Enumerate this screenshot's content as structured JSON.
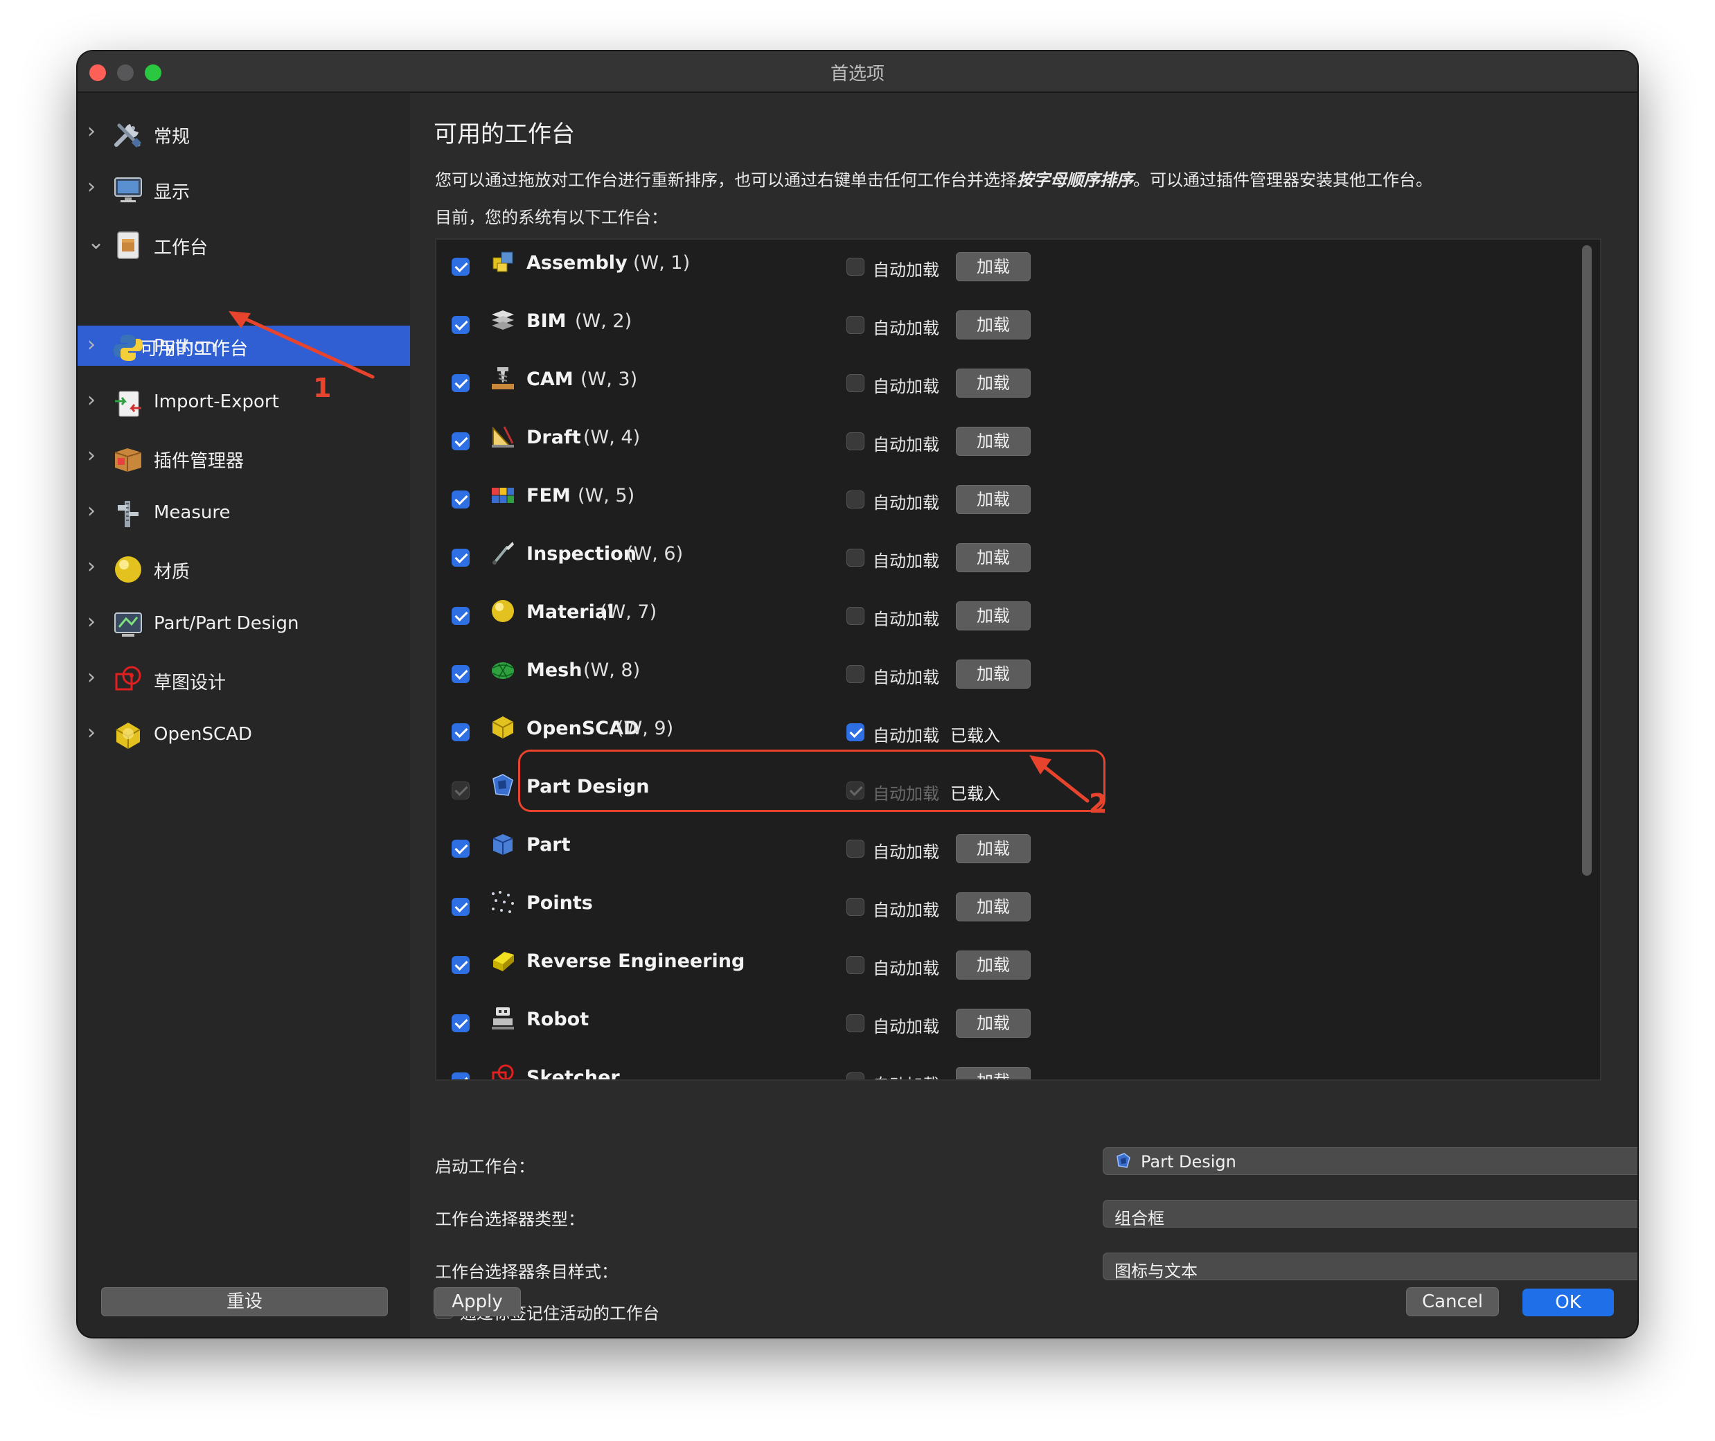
{
  "window": {
    "title": "首选项"
  },
  "sidebar": {
    "items": [
      {
        "label": "常规",
        "chevron": "›",
        "icon": "tools-icon"
      },
      {
        "label": "显示",
        "chevron": "›",
        "icon": "monitor-icon"
      },
      {
        "label": "工作台",
        "chevron": "⌄",
        "icon": "workbench-icon"
      },
      {
        "label": "可用的工作台",
        "selected": true
      },
      {
        "label": "Python",
        "chevron": "›",
        "icon": "python-icon"
      },
      {
        "label": "Import-Export",
        "chevron": "›",
        "icon": "import-export-icon"
      },
      {
        "label": "插件管理器",
        "chevron": "›",
        "icon": "addon-manager-icon"
      },
      {
        "label": "Measure",
        "chevron": "›",
        "icon": "measure-icon"
      },
      {
        "label": "材质",
        "chevron": "›",
        "icon": "material-icon"
      },
      {
        "label": "Part/Part Design",
        "chevron": "›",
        "icon": "part-design-icon"
      },
      {
        "label": "草图设计",
        "chevron": "›",
        "icon": "sketcher-icon"
      },
      {
        "label": "OpenSCAD",
        "chevron": "›",
        "icon": "openscad-icon"
      }
    ],
    "reset_label": "重设"
  },
  "main": {
    "heading": "可用的工作台",
    "description_before": "您可以通过拖放对工作台进行重新排序，也可以通过右键单击任何工作台并选择",
    "description_em": "按字母顺序排序",
    "description_after": "。可以通过插件管理器安装其他工作台。",
    "subdescription": "目前，您的系统有以下工作台：",
    "autoload_label": "自动加载",
    "load_label": "加载",
    "loaded_label": "已载入",
    "workbenches": [
      {
        "name": "Assembly",
        "code": "(W, 1)",
        "enabled": true,
        "autoload": false,
        "loaded": false,
        "icon": "assembly-icon"
      },
      {
        "name": "BIM",
        "code": "(W, 2)",
        "enabled": true,
        "autoload": false,
        "loaded": false,
        "icon": "bim-icon"
      },
      {
        "name": "CAM",
        "code": "(W, 3)",
        "enabled": true,
        "autoload": false,
        "loaded": false,
        "icon": "cam-icon"
      },
      {
        "name": "Draft",
        "code": "(W, 4)",
        "enabled": true,
        "autoload": false,
        "loaded": false,
        "icon": "draft-icon"
      },
      {
        "name": "FEM",
        "code": "(W, 5)",
        "enabled": true,
        "autoload": false,
        "loaded": false,
        "icon": "fem-icon"
      },
      {
        "name": "Inspection",
        "code": "(W, 6)",
        "enabled": true,
        "autoload": false,
        "loaded": false,
        "icon": "inspection-icon"
      },
      {
        "name": "Material",
        "code": "(W, 7)",
        "enabled": true,
        "autoload": false,
        "loaded": false,
        "icon": "material-icon"
      },
      {
        "name": "Mesh",
        "code": "(W, 8)",
        "enabled": true,
        "autoload": false,
        "loaded": false,
        "icon": "mesh-icon"
      },
      {
        "name": "OpenSCAD",
        "code": "(W, 9)",
        "enabled": true,
        "autoload": true,
        "loaded": true,
        "icon": "openscad-icon"
      },
      {
        "name": "Part Design",
        "code": "",
        "enabled": true,
        "autoload": true,
        "loaded": true,
        "disabled": true,
        "icon": "part-design-icon"
      },
      {
        "name": "Part",
        "code": "",
        "enabled": true,
        "autoload": false,
        "loaded": false,
        "icon": "part-icon"
      },
      {
        "name": "Points",
        "code": "",
        "enabled": true,
        "autoload": false,
        "loaded": false,
        "icon": "points-icon"
      },
      {
        "name": "Reverse Engineering",
        "code": "",
        "enabled": true,
        "autoload": false,
        "loaded": false,
        "icon": "reverse-engineering-icon"
      },
      {
        "name": "Robot",
        "code": "",
        "enabled": true,
        "autoload": false,
        "loaded": false,
        "icon": "robot-icon"
      },
      {
        "name": "Sketcher",
        "code": "",
        "enabled": true,
        "autoload": false,
        "loaded": false,
        "icon": "sketcher-icon"
      }
    ],
    "startup_label": "启动工作台：",
    "startup_value": "Part Design",
    "selector_type_label": "工作台选择器类型：",
    "selector_type_value": "组合框",
    "selector_style_label": "工作台选择器条目样式：",
    "selector_style_value": "图标与文本",
    "remember_label": "通过标签记住活动的工作台",
    "remember_checked": false,
    "apply_label": "Apply",
    "cancel_label": "Cancel",
    "ok_label": "OK"
  },
  "annotations": {
    "one": "1",
    "two": "2"
  },
  "colors": {
    "accent": "#2f6fe4",
    "selection": "#2f5fd3",
    "annotation": "#e8432d"
  }
}
